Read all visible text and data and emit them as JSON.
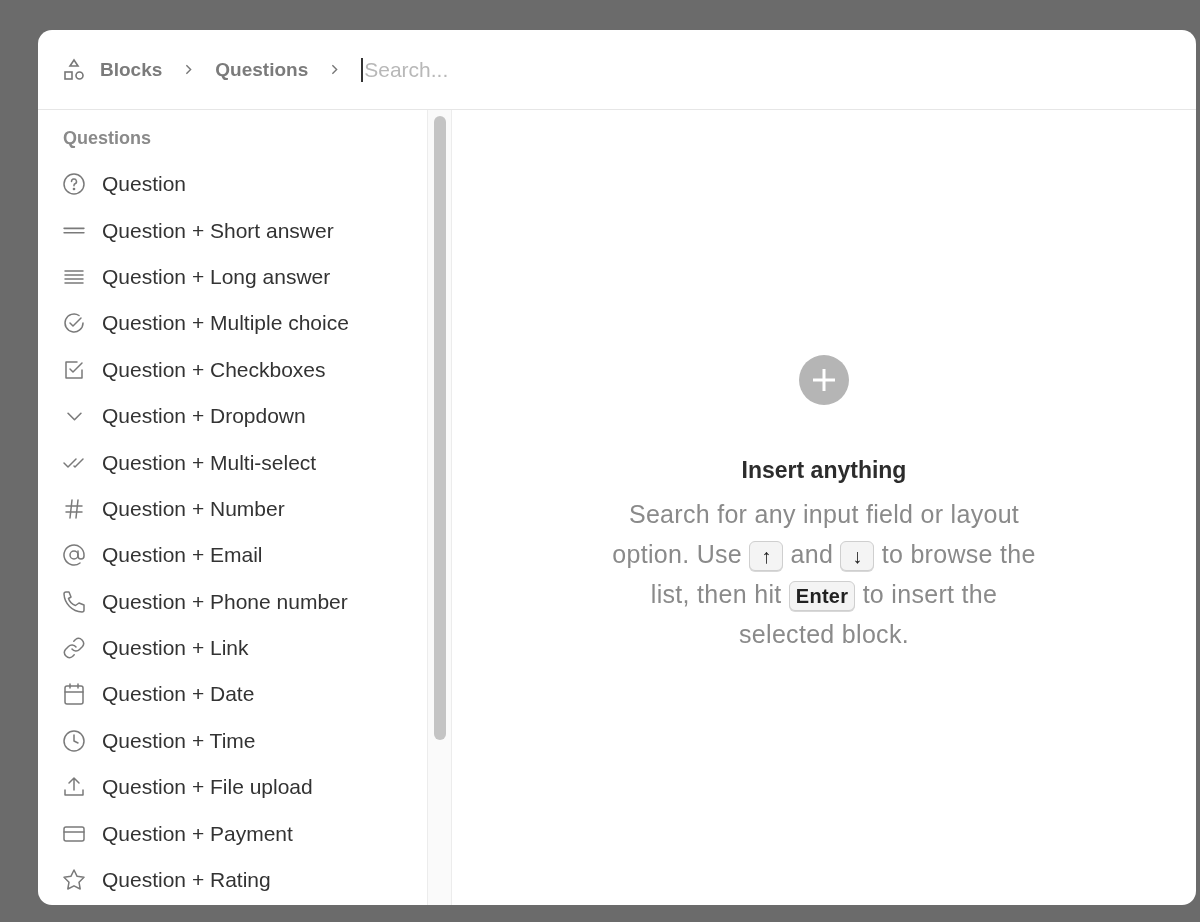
{
  "breadcrumb": [
    {
      "label": "Blocks"
    },
    {
      "label": "Questions"
    }
  ],
  "search": {
    "placeholder": "Search..."
  },
  "sidebar": {
    "heading": "Questions",
    "items": [
      {
        "label": "Question",
        "selected": false
      },
      {
        "label": "Question + Short answer",
        "selected": false
      },
      {
        "label": "Question + Long answer",
        "selected": false
      },
      {
        "label": "Question + Multiple choice",
        "selected": false
      },
      {
        "label": "Question + Checkboxes",
        "selected": false
      },
      {
        "label": "Question + Dropdown",
        "selected": false
      },
      {
        "label": "Question + Multi-select",
        "selected": false
      },
      {
        "label": "Question + Number",
        "selected": false
      },
      {
        "label": "Question + Email",
        "selected": false
      },
      {
        "label": "Question + Phone number",
        "selected": false
      },
      {
        "label": "Question + Link",
        "selected": false
      },
      {
        "label": "Question + Date",
        "selected": false
      },
      {
        "label": "Question + Time",
        "selected": false
      },
      {
        "label": "Question + File upload",
        "selected": false
      },
      {
        "label": "Question + Payment",
        "selected": false
      },
      {
        "label": "Question + Rating",
        "selected": false
      }
    ]
  },
  "empty_state": {
    "title": "Insert anything",
    "description": [
      {
        "kind": "text",
        "text": "Search for any input field or layout"
      },
      {
        "kind": "text",
        "text": "option. Use"
      },
      {
        "kind": "key",
        "text": "↑"
      },
      {
        "kind": "text",
        "text": "and"
      },
      {
        "kind": "key",
        "text": "↓"
      },
      {
        "kind": "text",
        "text": "to browse the"
      },
      {
        "kind": "text",
        "text": "list, then hit"
      },
      {
        "kind": "key",
        "text": "Enter"
      },
      {
        "kind": "text",
        "text": "to insert the"
      },
      {
        "kind": "text",
        "text": "selected block."
      }
    ]
  }
}
